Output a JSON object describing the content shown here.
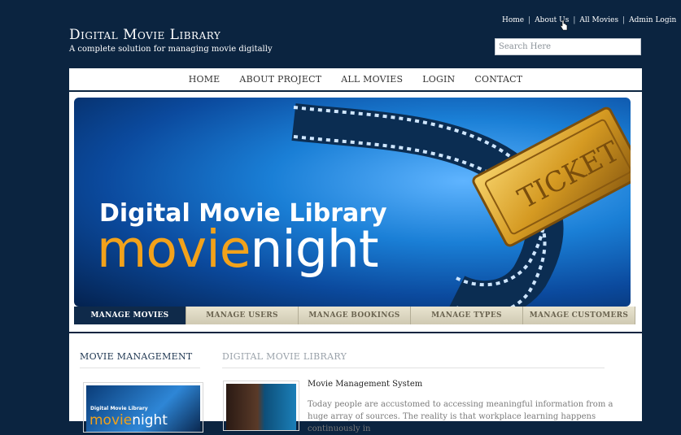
{
  "header": {
    "title": "Digital Movie Library",
    "tagline": "A complete solution for managing movie digitally",
    "top_links": [
      "Home",
      "About Us",
      "All Movies",
      "Admin Login"
    ],
    "search_placeholder": "Search Here"
  },
  "nav": {
    "items": [
      "HOME",
      "ABOUT PROJECT",
      "ALL MOVIES",
      "LOGIN",
      "CONTACT"
    ]
  },
  "banner": {
    "line1": "Digital Movie Library",
    "line2_a": "movie",
    "line2_b": "night",
    "ticket_text": "TICKET"
  },
  "tabs": [
    "MANAGE MOVIES",
    "MANAGE USERS",
    "MANAGE BOOKINGS",
    "MANAGE TYPES",
    "MANAGE CUSTOMERS"
  ],
  "content": {
    "left_heading": "MOVIE MANAGEMENT",
    "right_heading": "DIGITAL MOVIE LIBRARY",
    "thumb_line1": "Digital Movie Library",
    "thumb_line2_a": "movie",
    "thumb_line2_b": "night",
    "article_title": "Movie Management System",
    "article_text": "Today people are accustomed to accessing meaningful information from a huge array of sources. The reality is that workplace learning happens continuously in"
  },
  "colors": {
    "background": "#0b2440",
    "active_tab": "#0f2a4a",
    "accent_orange": "#f2a21b"
  }
}
